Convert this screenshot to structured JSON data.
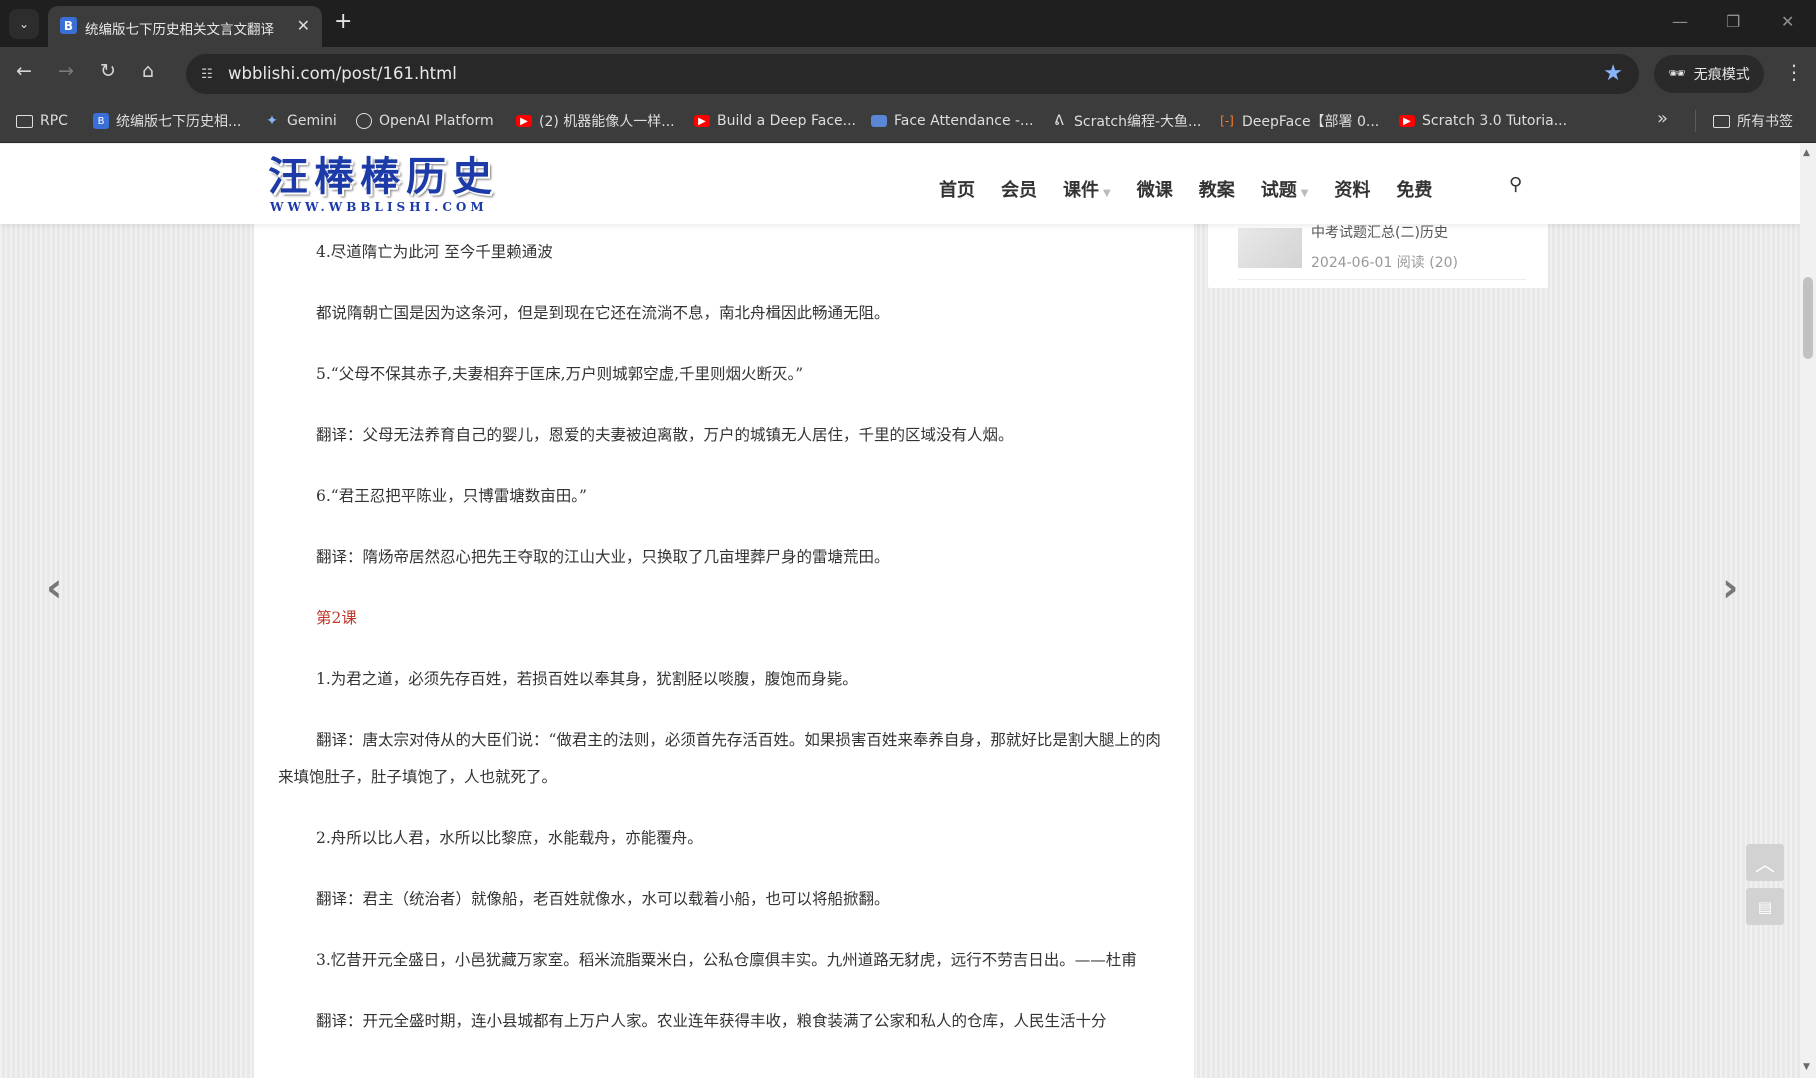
{
  "browser": {
    "tab_title": "统编版七下历史相关文言文翻译",
    "url": "wbblishi.com/post/161.html",
    "incognito_label": "无痕模式",
    "bookmarks": [
      {
        "label": "RPC",
        "icon": "folder-icon"
      },
      {
        "label": "统编版七下历史相...",
        "icon": "b-favicon"
      },
      {
        "label": "Gemini",
        "icon": "gemini-icon"
      },
      {
        "label": "OpenAI Platform",
        "icon": "openai-icon"
      },
      {
        "label": "(2) 机器能像人一样...",
        "icon": "youtube-icon"
      },
      {
        "label": "Build a Deep Face...",
        "icon": "youtube-icon"
      },
      {
        "label": "Face Attendance -...",
        "icon": "card-icon"
      },
      {
        "label": "Scratch编程-大鱼...",
        "icon": "scratch-icon"
      },
      {
        "label": "DeepFace【部署 0...",
        "icon": "bracket-icon"
      },
      {
        "label": "Scratch 3.0 Tutoria...",
        "icon": "youtube-icon"
      }
    ],
    "all_bookmarks": "所有书签",
    "colors": {
      "tabstrip": "#1f1f1f",
      "toolbar": "#3c3c3c",
      "star": "#8ab4f8",
      "youtube": "#ff0000"
    }
  },
  "site": {
    "logo_text": "汪棒棒历史",
    "logo_sub": "WWW.WBBLISHI.COM",
    "nav": [
      "首页",
      "会员",
      "课件",
      "微课",
      "教案",
      "试题",
      "资料",
      "免费"
    ],
    "logo_color": "#1c3aa8"
  },
  "sidebar": {
    "item_title": "中考试题汇总(二)历史",
    "item_meta": "2024-06-01 阅读 (20)"
  },
  "article": {
    "paragraphs": [
      "4.尽道隋亡为此河 至今千里赖通波",
      "都说隋朝亡国是因为这条河，但是到现在它还在流淌不息，南北舟楫因此畅通无阻。",
      "5.“父母不保其赤子,夫妻相弃于匡床,万户则城郭空虚,千里则烟火断灭。”",
      "翻译：父母无法养育自己的婴儿，恩爱的夫妻被迫离散，万户的城镇无人居住，千里的区域没有人烟。",
      "6.“君王忍把平陈业，只博雷塘数亩田。”",
      "翻译：隋炀帝居然忍心把先王夺取的江山大业，只换取了几亩埋葬尸身的雷塘荒田。",
      "第2课",
      "1.为君之道，必须先存百姓，若损百姓以奉其身，犹割胫以啖腹，腹饱而身毙。",
      "翻译：唐太宗对侍从的大臣们说：“做君主的法则，必须首先存活百姓。如果损害百姓来奉养自身，那就好比是割大腿上的肉来填饱肚子，肚子填饱了，人也就死了。",
      "2.舟所以比人君，水所以比黎庶，水能载舟，亦能覆舟。",
      "翻译：君主（统治者）就像船，老百姓就像水，水可以载着小船，也可以将船掀翻。",
      "3.忆昔开元全盛日，小邑犹藏万家室。稻米流脂粟米白，公私仓廪俱丰实。九州道路无豺虎，远行不劳吉日出。——杜甫",
      "翻译：开元全盛时期，连小县城都有上万户人家。农业连年获得丰收，粮食装满了公家和私人的仓库，人民生活十分"
    ],
    "red_paragraph_index": 6,
    "text_color": "#333333",
    "heading_color": "#c0392b"
  }
}
